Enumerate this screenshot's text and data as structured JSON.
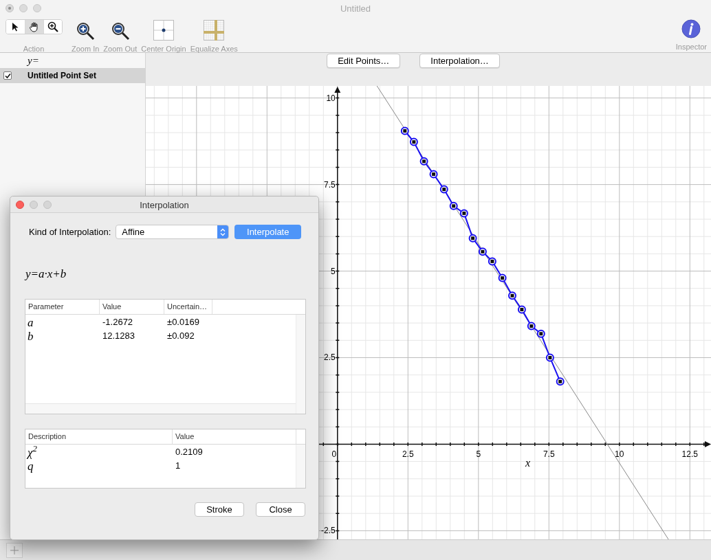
{
  "window": {
    "title": "Untitled"
  },
  "toolbar": {
    "action_tools": [
      {
        "kind": "arrow",
        "selected": false
      },
      {
        "kind": "hand",
        "selected": true
      },
      {
        "kind": "zoom",
        "selected": false
      }
    ],
    "action_label": "Action",
    "items": [
      {
        "kind": "zoom_in",
        "label": "Zoom In"
      },
      {
        "kind": "zoom_out",
        "label": "Zoom Out"
      },
      {
        "kind": "center_origin",
        "label": "Center Origin"
      },
      {
        "kind": "equalize_axes",
        "label": "Equalize Axes"
      }
    ],
    "inspector": {
      "label": "Inspector"
    }
  },
  "sidebar": {
    "header": "y=",
    "items": [
      {
        "label": "Untitled Point Set",
        "checked": true,
        "selected": true
      }
    ]
  },
  "graph_buttons": [
    "Edit Points…",
    "Interpolation…"
  ],
  "graph": {
    "chart_data": {
      "type": "line",
      "xlabel": "x",
      "xlim": [
        -6.8,
        13.25
      ],
      "ylim": [
        -2.75,
        10.35
      ],
      "xticks": [
        0,
        2.5,
        5,
        7.5,
        10,
        12.5
      ],
      "grid": true,
      "yticks": [
        -2.5,
        2.5,
        5,
        7.5,
        10
      ],
      "x": [
        1.4,
        2.39,
        2.71,
        3.07,
        3.41,
        3.78,
        4.12,
        4.49,
        4.8,
        5.15,
        5.49,
        5.85,
        6.2,
        6.54,
        6.88,
        7.22,
        7.54,
        7.9,
        11.74
      ],
      "series": [
        {
          "color": "#1a10f0",
          "marker": "circle",
          "values": [
            null,
            9.05,
            8.73,
            8.17,
            7.8,
            7.36,
            6.88,
            6.67,
            5.95,
            5.56,
            5.28,
            4.8,
            4.29,
            3.89,
            3.41,
            3.19,
            2.5,
            1.81,
            null
          ]
        },
        {
          "color": "#8a8a8a",
          "values": [
            10.35,
            9.1,
            8.69,
            8.24,
            7.81,
            7.34,
            6.91,
            6.44,
            6.05,
            5.6,
            5.17,
            4.72,
            4.27,
            3.84,
            3.41,
            2.98,
            2.57,
            2.12,
            -2.75
          ]
        }
      ]
    }
  },
  "dialog": {
    "title": "Interpolation",
    "kind_label": "Kind of Interpolation:",
    "kind_value": "Affine",
    "interpolate_button": "Interpolate",
    "formula": "y=a·x+b",
    "parameters": {
      "columns": [
        "Parameter",
        "Value",
        "Uncertain…"
      ],
      "rows": [
        {
          "parameter": "a",
          "value": "-1.2672",
          "uncertainty": "±0.0169"
        },
        {
          "parameter": "b",
          "value": "12.1283",
          "uncertainty": "±0.092"
        }
      ]
    },
    "statistics": {
      "columns": [
        "Description",
        "Value"
      ],
      "rows": [
        {
          "description": "χ$^{2}$",
          "value": "0.2109"
        },
        {
          "description": "q",
          "value": "1"
        }
      ]
    },
    "buttons": [
      "Stroke",
      "Close"
    ]
  }
}
